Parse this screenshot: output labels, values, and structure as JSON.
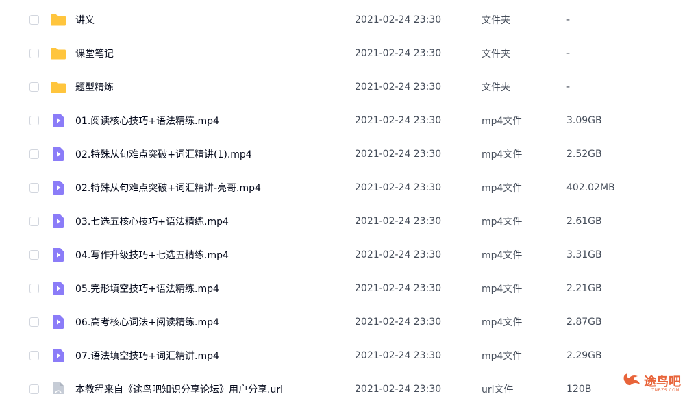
{
  "colors": {
    "folder": "#ffc53d",
    "video": "#8b7cf8",
    "url_file": "#c6ccd6",
    "watermark": "#e8643a"
  },
  "files": [
    {
      "icon": "folder-icon",
      "name": "讲义",
      "date": "2021-02-24 23:30",
      "type": "文件夹",
      "size": "-"
    },
    {
      "icon": "folder-icon",
      "name": "课堂笔记",
      "date": "2021-02-24 23:30",
      "type": "文件夹",
      "size": "-"
    },
    {
      "icon": "folder-icon",
      "name": "题型精炼",
      "date": "2021-02-24 23:30",
      "type": "文件夹",
      "size": "-"
    },
    {
      "icon": "video-file-icon",
      "name": "01.阅读核心技巧+语法精练.mp4",
      "date": "2021-02-24 23:30",
      "type": "mp4文件",
      "size": "3.09GB"
    },
    {
      "icon": "video-file-icon",
      "name": "02.特殊从句难点突破+词汇精讲(1).mp4",
      "date": "2021-02-24 23:30",
      "type": "mp4文件",
      "size": "2.52GB"
    },
    {
      "icon": "video-file-icon",
      "name": "02.特殊从句难点突破+词汇精讲-亮哥.mp4",
      "date": "2021-02-24 23:30",
      "type": "mp4文件",
      "size": "402.02MB"
    },
    {
      "icon": "video-file-icon",
      "name": "03.七选五核心技巧+语法精练.mp4",
      "date": "2021-02-24 23:30",
      "type": "mp4文件",
      "size": "2.61GB"
    },
    {
      "icon": "video-file-icon",
      "name": "04.写作升级技巧+七选五精练.mp4",
      "date": "2021-02-24 23:30",
      "type": "mp4文件",
      "size": "3.31GB"
    },
    {
      "icon": "video-file-icon",
      "name": "05.完形填空技巧+语法精练.mp4",
      "date": "2021-02-24 23:30",
      "type": "mp4文件",
      "size": "2.21GB"
    },
    {
      "icon": "video-file-icon",
      "name": "06.高考核心词法+阅读精练.mp4",
      "date": "2021-02-24 23:30",
      "type": "mp4文件",
      "size": "2.87GB"
    },
    {
      "icon": "video-file-icon",
      "name": "07.语法填空技巧+词汇精讲.mp4",
      "date": "2021-02-24 23:30",
      "type": "mp4文件",
      "size": "2.29GB"
    },
    {
      "icon": "url-file-icon",
      "name": "本教程来自《途鸟吧知识分享论坛》用户分享.url",
      "date": "2021-02-24 23:30",
      "type": "url文件",
      "size": "120B"
    }
  ],
  "watermark": {
    "text": "途鸟吧",
    "sub": "TNBZS.COM"
  }
}
